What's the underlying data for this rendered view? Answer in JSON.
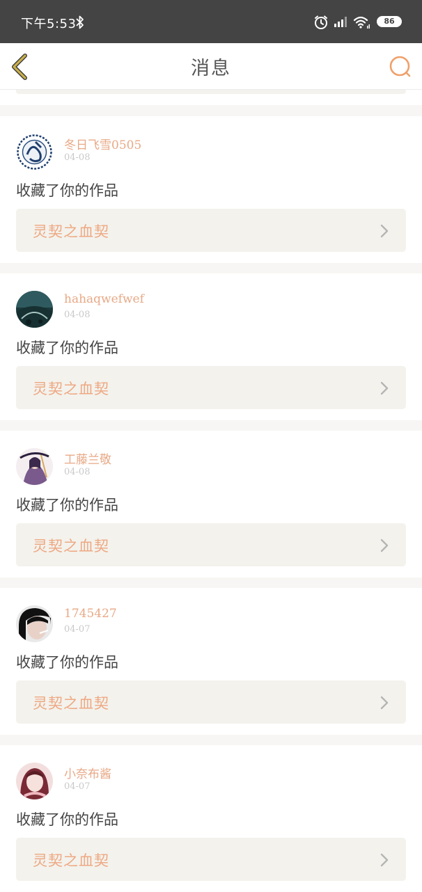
{
  "status_bar": {
    "time": "下午5:53",
    "battery": "86"
  },
  "header": {
    "title": "消息"
  },
  "icons": {
    "back": "chevron-left-icon",
    "search": "search-icon",
    "link_arrow": "chevron-right-icon"
  },
  "colors": {
    "accent": "#eea882",
    "back_arrow": "#cbb04a",
    "search_ring": "#f0a06a",
    "status_bar_bg": "#444444",
    "link_bg": "#f3f2ed"
  },
  "messages": [
    {
      "user": "冬日飞雪0505",
      "date": "04-08",
      "text": "收藏了你的作品",
      "work": "灵契之血契"
    },
    {
      "user": "hahaqwefwef",
      "date": "04-08",
      "text": "收藏了你的作品",
      "work": "灵契之血契"
    },
    {
      "user": "工藤兰敬",
      "date": "04-08",
      "text": "收藏了你的作品",
      "work": "灵契之血契"
    },
    {
      "user": "1745427",
      "date": "04-07",
      "text": "收藏了你的作品",
      "work": "灵契之血契"
    },
    {
      "user": "小奈布酱",
      "date": "04-07",
      "text": "收藏了你的作品",
      "work": "灵契之血契"
    }
  ]
}
